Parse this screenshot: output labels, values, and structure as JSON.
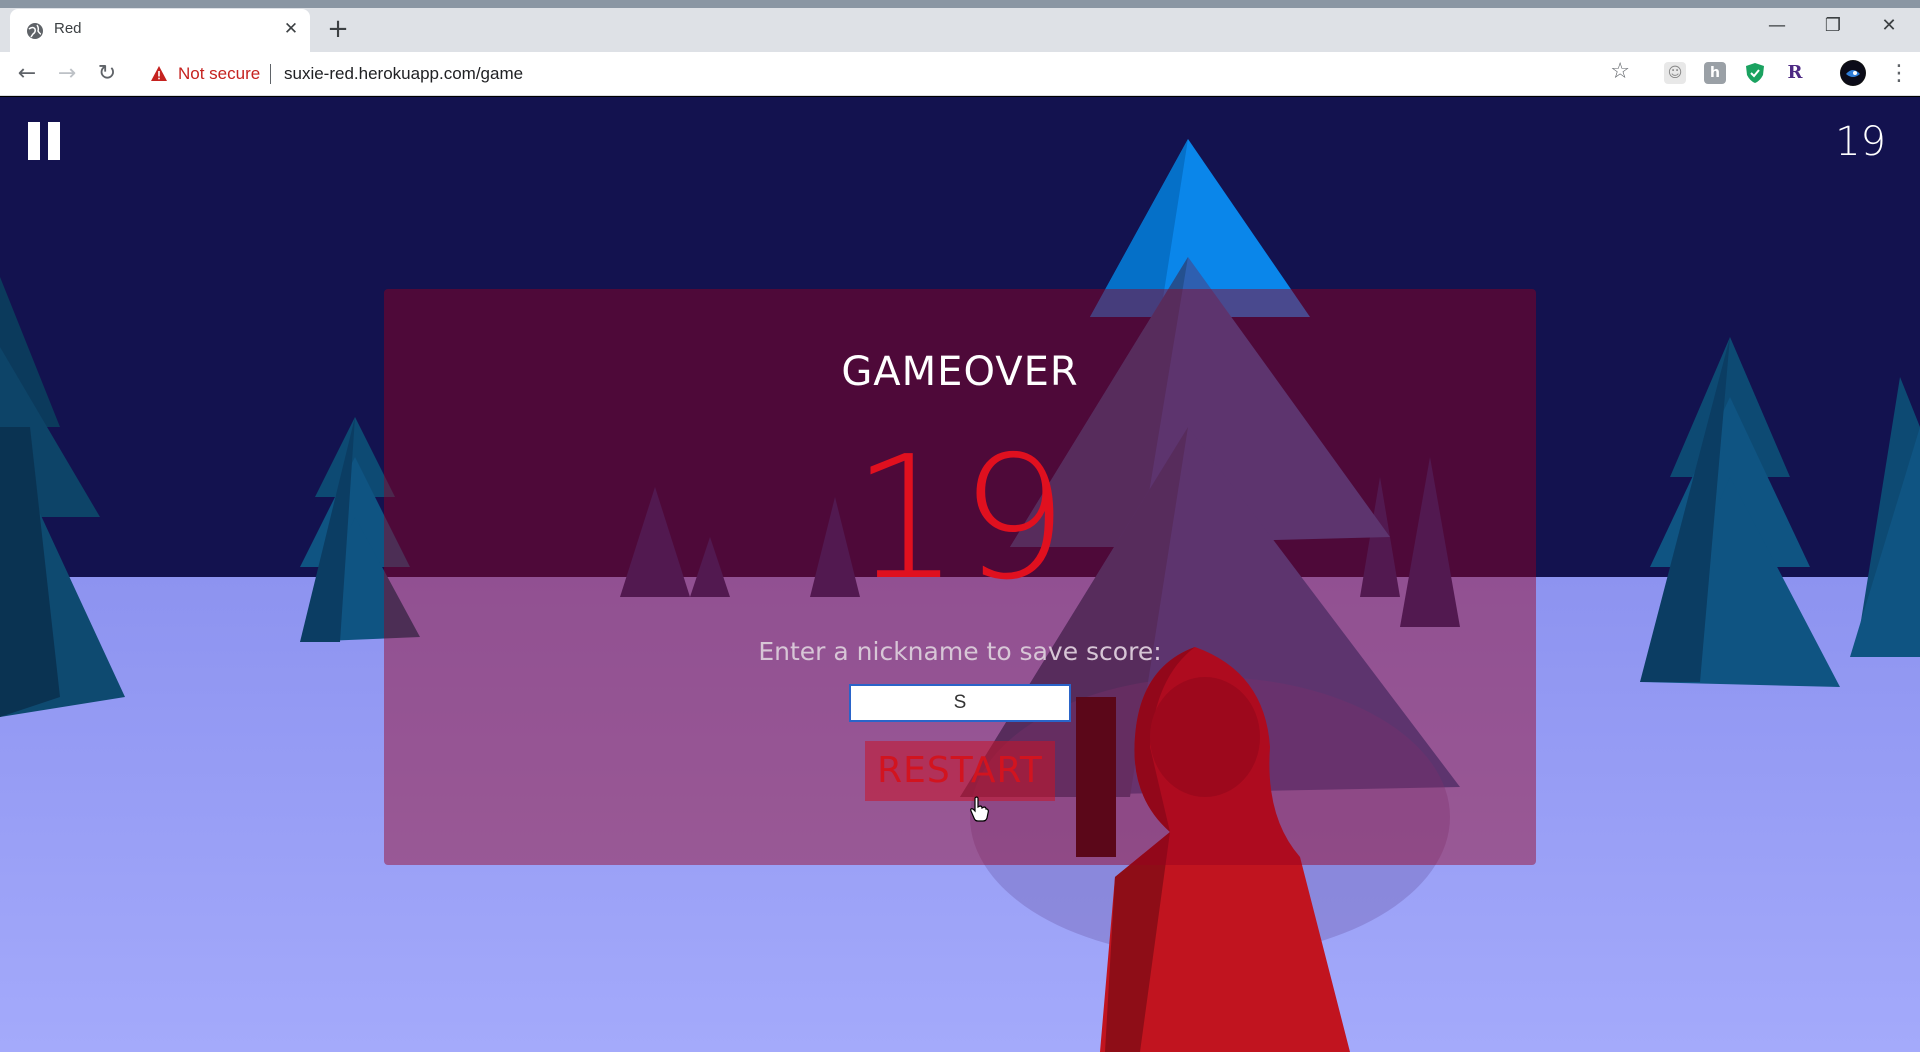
{
  "browser": {
    "tab_title": "Red",
    "tab_close": "✕",
    "new_tab": "+",
    "minimize": "—",
    "maximize": "❐",
    "close": "✕",
    "back": "←",
    "forward": "→",
    "reload": "↻",
    "security_label": "Not secure",
    "url": "suxie-red.herokuapp.com/game",
    "bookmark_star": "☆",
    "menu": "⋮",
    "extensions": [
      "ghost-extension-icon",
      "h-extension-icon",
      "shield-extension-icon",
      "r-extension-icon",
      "profile-avatar-icon"
    ]
  },
  "game": {
    "hud_score": "19",
    "gameover_title": "GAMEOVER",
    "final_score": "19",
    "nickname_prompt": "Enter a nickname to save score:",
    "nickname_value": "S",
    "restart_label": "RESTART"
  },
  "colors": {
    "sky": "#13124f",
    "snow": "#9aa0fb",
    "overlay": "#96001e",
    "score_red": "#e0101f",
    "cloak_red": "#c1141f",
    "tree_blue": "#0884e8"
  }
}
